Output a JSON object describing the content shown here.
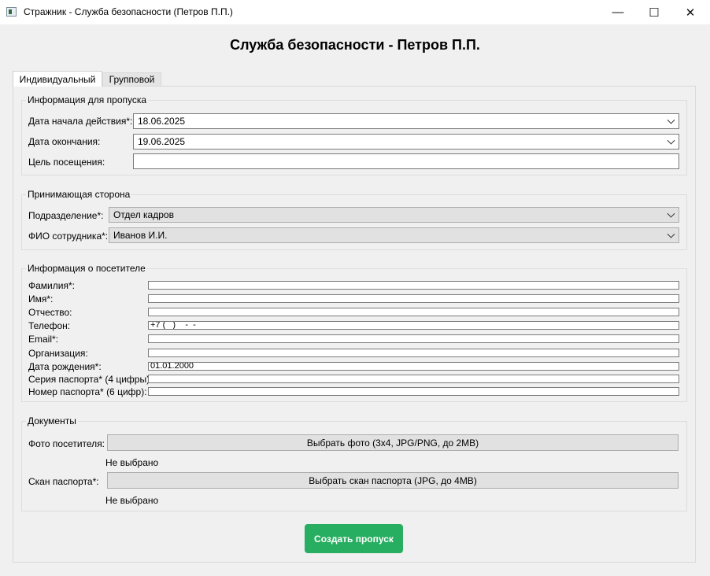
{
  "window": {
    "title": "Стражник - Служба безопасности (Петров П.П.)",
    "minimize": "—",
    "maximize": "☐",
    "close": "✕"
  },
  "header": {
    "title": "Служба безопасности - Петров П.П."
  },
  "tabs": [
    {
      "label": "Индивидуальный",
      "active": true
    },
    {
      "label": "Групповой",
      "active": false
    }
  ],
  "pass_info": {
    "legend": "Информация для пропуска",
    "start_label": "Дата начала действия*:",
    "start_value": "18.06.2025",
    "end_label": "Дата окончания:",
    "end_value": "19.06.2025",
    "purpose_label": "Цель посещения:",
    "purpose_value": ""
  },
  "host": {
    "legend": "Принимающая сторона",
    "department_label": "Подразделение*:",
    "department_value": "Отдел кадров",
    "employee_label": "ФИО сотрудника*:",
    "employee_value": "Иванов И.И."
  },
  "visitor": {
    "legend": "Информация о посетителе",
    "lastname_label": "Фамилия*:",
    "firstname_label": "Имя*:",
    "patronymic_label": "Отчество:",
    "phone_label": "Телефон:",
    "phone_value": "+7 (   )    -  -",
    "email_label": "Email*:",
    "org_label": "Организация:",
    "birth_label": "Дата рождения*:",
    "birth_value": "01.01.2000",
    "passport_series_label": "Серия паспорта* (4 цифры):",
    "passport_number_label": "Номер паспорта* (6 цифр):"
  },
  "documents": {
    "legend": "Документы",
    "photo_label": "Фото посетителя:",
    "photo_button": "Выбрать фото (3x4, JPG/PNG, до 2MB)",
    "photo_status": "Не выбрано",
    "scan_label": "Скан паспорта*:",
    "scan_button": "Выбрать скан паспорта (JPG, до 4MB)",
    "scan_status": "Не выбрано"
  },
  "actions": {
    "create_label": "Создать пропуск"
  },
  "colors": {
    "accent": "#27ae60"
  }
}
